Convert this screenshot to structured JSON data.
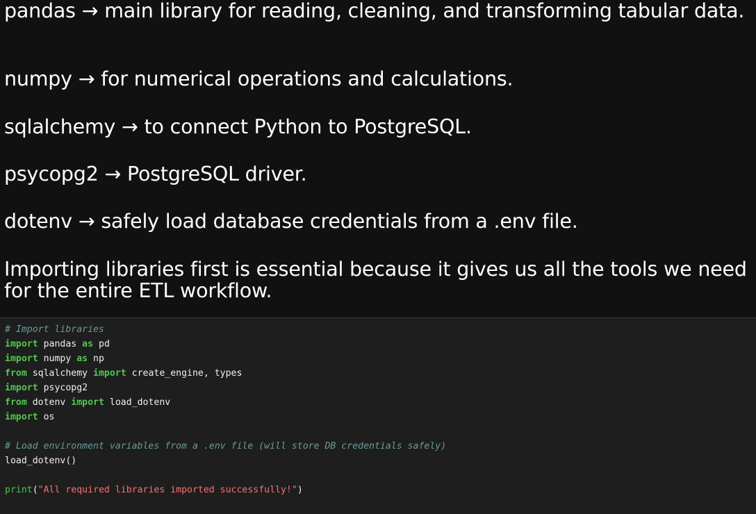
{
  "markdown": {
    "paragraphs": [
      "pandas → main library for reading, cleaning, and transforming tabular data.",
      "numpy → for numerical operations and calculations.",
      "sqlalchemy → to connect Python to PostgreSQL.",
      "psycopg2 → PostgreSQL driver.",
      "dotenv → safely load database credentials from a .env file.",
      "Importing libraries first is essential because it gives us all the tools we need for the entire ETL workflow."
    ]
  },
  "code": {
    "comment1": "# Import libraries",
    "line_pandas": {
      "kw1": "import",
      "mod": " pandas ",
      "kw2": "as",
      "alias": " pd"
    },
    "line_numpy": {
      "kw1": "import",
      "mod": " numpy ",
      "kw2": "as",
      "alias": " np"
    },
    "line_sqlalchemy": {
      "kw1": "from",
      "mod": " sqlalchemy ",
      "kw2": "import",
      "names": " create_engine, types"
    },
    "line_psycopg2": {
      "kw1": "import",
      "mod": " psycopg2"
    },
    "line_dotenv": {
      "kw1": "from",
      "mod": " dotenv ",
      "kw2": "import",
      "names": " load_dotenv"
    },
    "line_os": {
      "kw1": "import",
      "mod": " os"
    },
    "comment2": "# Load environment variables from a .env file (will store DB credentials safely)",
    "call_load": "load_dotenv()",
    "print_fn": "print",
    "print_open": "(",
    "print_str": "\"All required libraries imported successfully!\"",
    "print_close": ")"
  },
  "colors": {
    "markdown_bg": "#111111",
    "code_bg": "#1e1e1e",
    "keyword": "#4ec94e",
    "comment": "#6a9a9a",
    "string": "#ff6e6e"
  }
}
